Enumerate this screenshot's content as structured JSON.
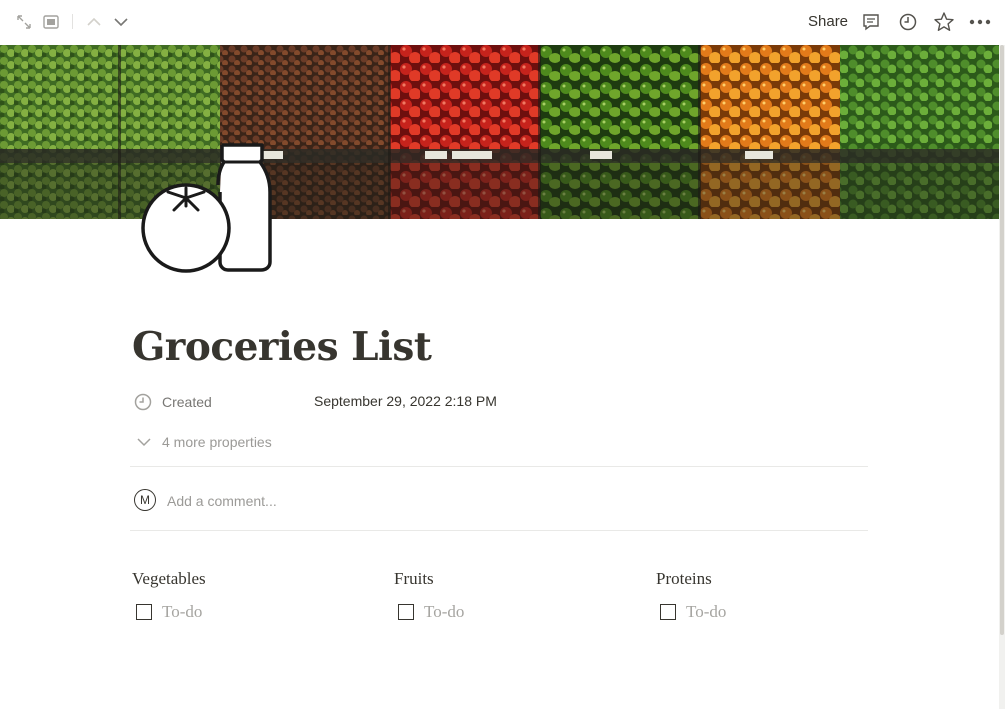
{
  "topbar": {
    "share_label": "Share",
    "icons": [
      "expand-icon",
      "peek-mode-icon",
      "chevron-up-icon",
      "chevron-down-icon",
      "comments-icon",
      "clock-icon",
      "star-icon",
      "more-icon"
    ]
  },
  "page": {
    "title": "Groceries List",
    "icon": "tomato-and-bottle-icon"
  },
  "properties": [
    {
      "icon": "clock-icon",
      "name": "Created",
      "value": "September 29, 2022 2:18 PM"
    }
  ],
  "more_properties_label": "4 more properties",
  "comment": {
    "avatar_initial": "M",
    "placeholder": "Add a comment..."
  },
  "columns": [
    {
      "heading": "Vegetables",
      "todo_placeholder": "To-do"
    },
    {
      "heading": "Fruits",
      "todo_placeholder": "To-do"
    },
    {
      "heading": "Proteins",
      "todo_placeholder": "To-do"
    }
  ],
  "colors": {
    "text": "#37352f",
    "muted": "#9b9a97",
    "divider": "#e9e9e7"
  }
}
